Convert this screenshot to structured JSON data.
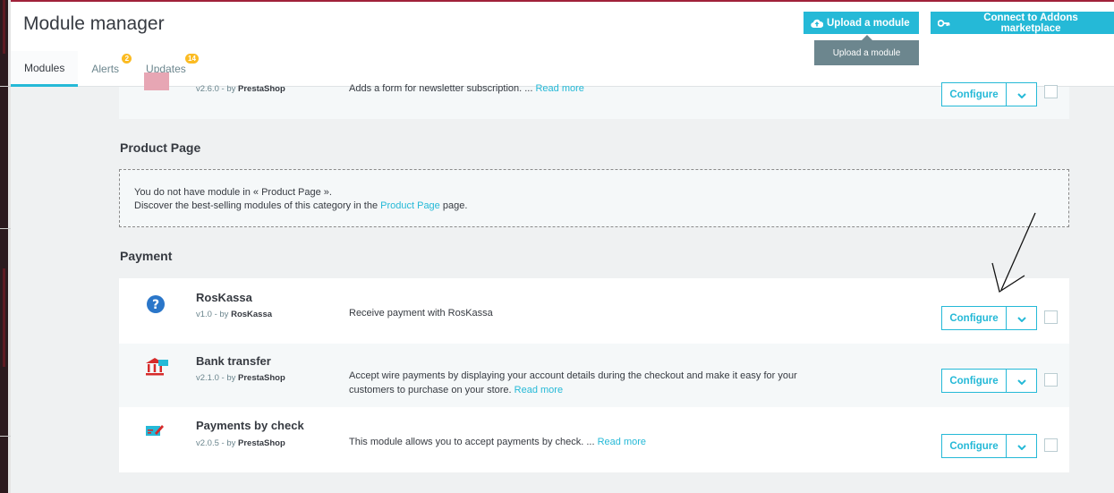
{
  "header": {
    "title": "Module manager",
    "upload_label": "Upload a module",
    "connect_label": "Connect to Addons marketplace",
    "tooltip": "Upload a module"
  },
  "tabs": [
    {
      "label": "Modules",
      "badge": ""
    },
    {
      "label": "Alerts",
      "badge": "2"
    },
    {
      "label": "Updates",
      "badge": "14"
    }
  ],
  "partial_module": {
    "version": "v2.6.0 - by",
    "author": "PrestaShop",
    "desc": "Adds a form for newsletter subscription. ...",
    "read_more": "Read more"
  },
  "product_page": {
    "title": "Product Page",
    "line1": "You do not have module in « Product Page ».",
    "line2_before": "Discover the best-selling modules of this category in the",
    "line2_link": "Product Page",
    "line2_after": "page."
  },
  "payment": {
    "title": "Payment",
    "modules": [
      {
        "name": "RosKassa",
        "version": "v1.0 - by",
        "author": "RosKassa",
        "desc": "Receive payment with RosKassa",
        "read_more": "",
        "icon": "question-icon"
      },
      {
        "name": "Bank transfer",
        "version": "v2.1.0 - by",
        "author": "PrestaShop",
        "desc": "Accept wire payments by displaying your account details during the checkout and make it easy for your customers to purchase on your store.",
        "read_more": "Read more",
        "icon": "bank-icon"
      },
      {
        "name": "Payments by check",
        "version": "v2.0.5 - by",
        "author": "PrestaShop",
        "desc": "This module allows you to accept payments by check. ...",
        "read_more": "Read more",
        "icon": "check-payment-icon"
      }
    ]
  },
  "configure_label": "Configure",
  "colors": {
    "accent": "#25b9d7",
    "text": "#363a41",
    "muted": "#6c868e",
    "badge": "#fbbb22"
  }
}
